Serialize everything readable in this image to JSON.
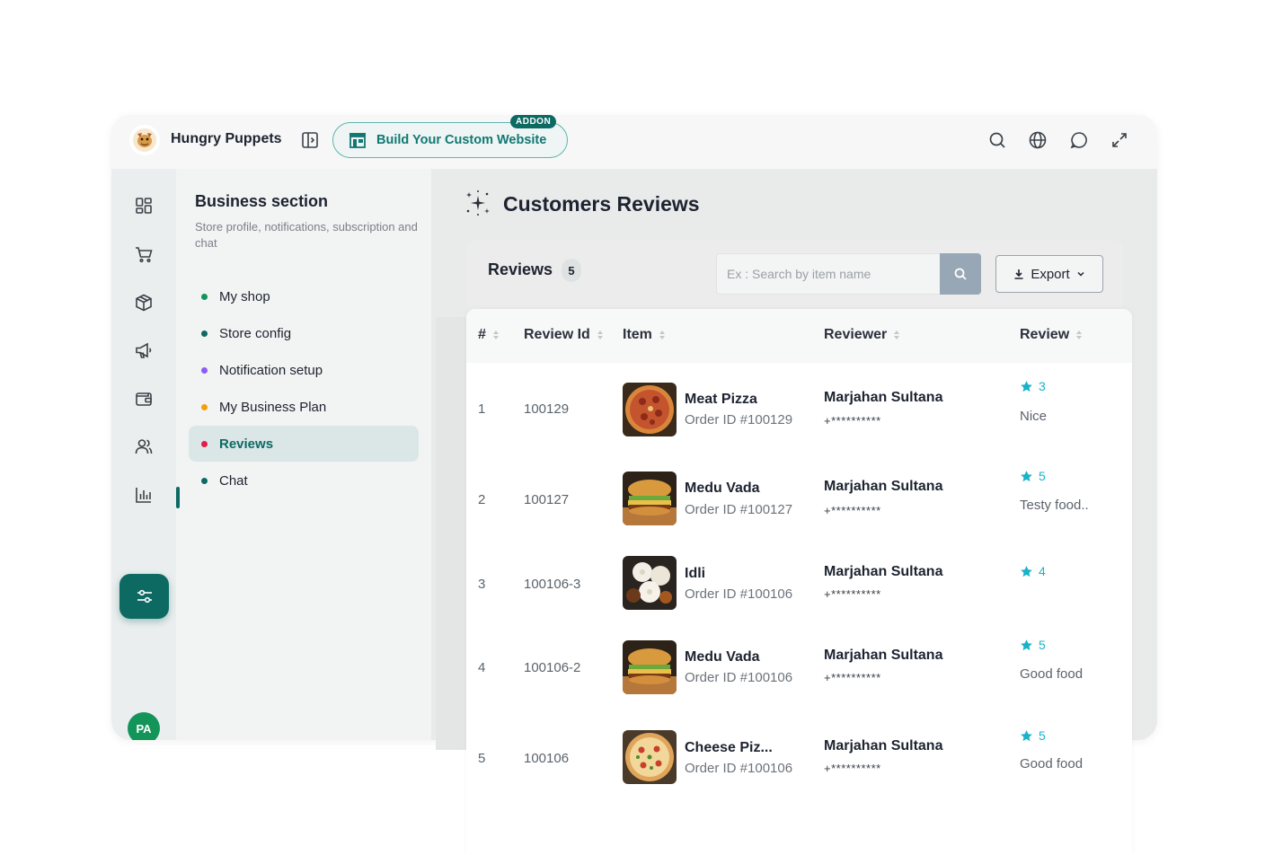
{
  "app": {
    "name": "Hungry Puppets"
  },
  "addon": {
    "label": "Build Your Custom Website",
    "badge": "ADDON"
  },
  "topbar": {
    "icons": [
      "search-icon",
      "globe-icon",
      "chat-icon",
      "expand-icon"
    ]
  },
  "rail": {
    "icons": [
      "dashboard-icon",
      "cart-icon",
      "box-icon",
      "megaphone-icon",
      "wallet-icon",
      "users-icon",
      "chart-icon",
      "settings-sliders-icon"
    ],
    "avatar": "PA"
  },
  "panel": {
    "title": "Business section",
    "subtitle": "Store profile, notifications, subscription and chat",
    "items": [
      {
        "label": "My shop",
        "color": "#13955a"
      },
      {
        "label": "Store config",
        "color": "#0d6a63"
      },
      {
        "label": "Notification setup",
        "color": "#8b5cf6"
      },
      {
        "label": "My Business Plan",
        "color": "#f59e0b"
      },
      {
        "label": "Reviews",
        "color": "#e11d48",
        "active": true
      },
      {
        "label": "Chat",
        "color": "#0d6a63"
      }
    ]
  },
  "main": {
    "title": "Customers Reviews",
    "reviews_label": "Reviews",
    "reviews_count": "5",
    "search_placeholder": "Ex : Search by item name",
    "export_label": "Export"
  },
  "table": {
    "headers": [
      "#",
      "Review Id",
      "Item",
      "Reviewer",
      "Review"
    ],
    "rows": [
      {
        "num": "1",
        "id": "100129",
        "item": "Meat Pizza",
        "order": "Order ID #100129",
        "reviewer": "Marjahan Sultana",
        "phone": "+**********",
        "rating": "3",
        "comment": "Nice",
        "food": "pizza"
      },
      {
        "num": "2",
        "id": "100127",
        "item": "Medu Vada",
        "order": "Order ID #100127",
        "reviewer": "Marjahan Sultana",
        "phone": "+**********",
        "rating": "5",
        "comment": "Testy food..",
        "food": "burger"
      },
      {
        "num": "3",
        "id": "100106-3",
        "item": "Idli",
        "order": "Order ID #100106",
        "reviewer": "Marjahan Sultana",
        "phone": "+**********",
        "rating": "4",
        "comment": "",
        "food": "idli"
      },
      {
        "num": "4",
        "id": "100106-2",
        "item": "Medu Vada",
        "order": "Order ID #100106",
        "reviewer": "Marjahan Sultana",
        "phone": "+**********",
        "rating": "5",
        "comment": "Good food",
        "food": "burger"
      },
      {
        "num": "5",
        "id": "100106",
        "item": "Cheese Piz...",
        "order": "Order ID #100106",
        "reviewer": "Marjahan Sultana",
        "phone": "+**********",
        "rating": "5",
        "comment": "Good food",
        "food": "cheese-pizza"
      }
    ]
  },
  "colors": {
    "accent": "#0d6a63",
    "star": "#19b3c9",
    "search_button": "#98a7b5"
  }
}
